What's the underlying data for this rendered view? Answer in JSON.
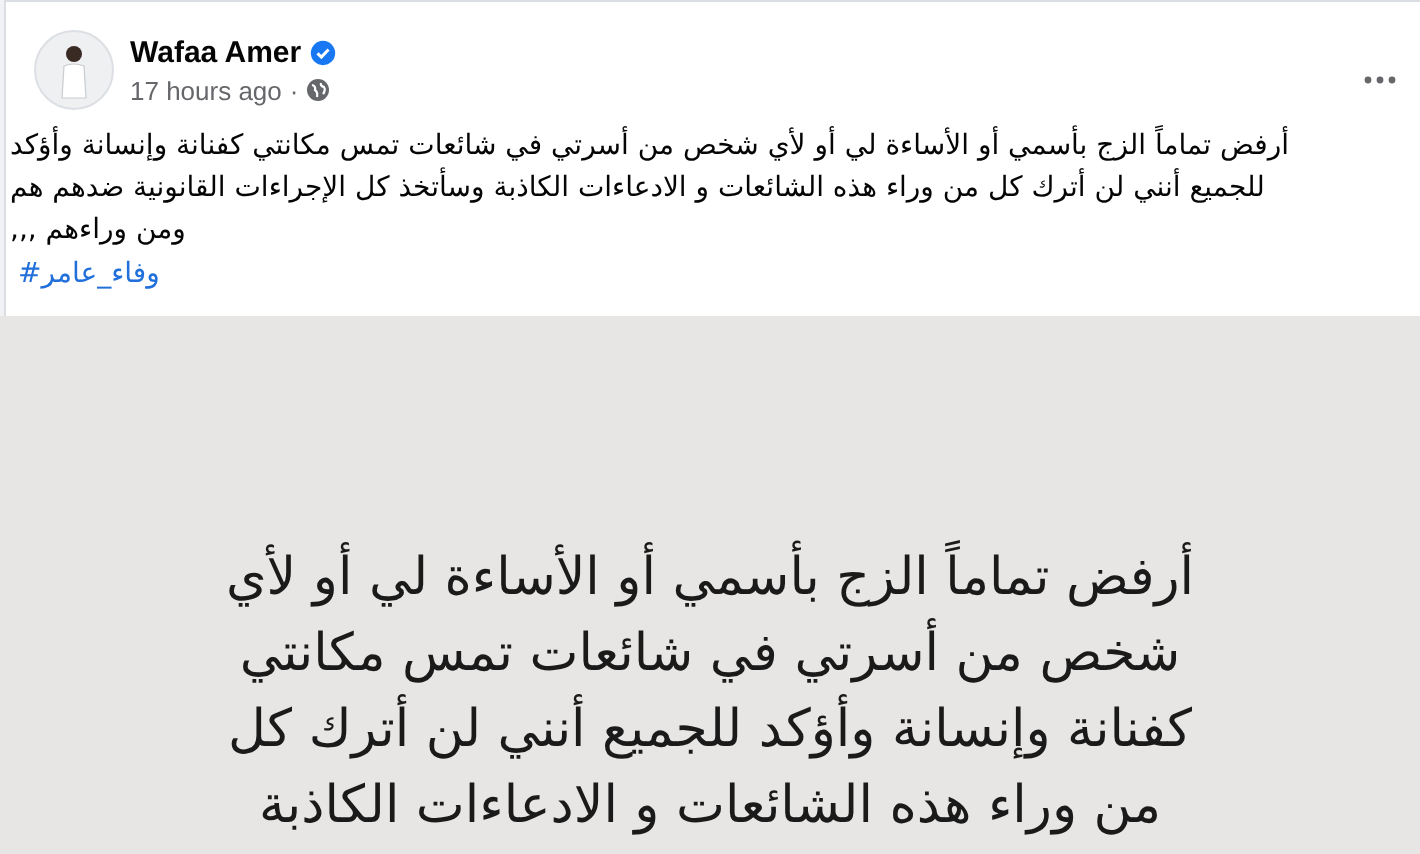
{
  "post": {
    "author": "Wafaa Amer",
    "verified": true,
    "time": "17 hours ago",
    "separator": "·",
    "caption_lines": [
      "أرفض تماماً الزج بأسمي أو الأساءة لي أو لأي شخص من أسرتي في شائعات تمس مكانتي كفنانة وإنسانة وأؤكد",
      "للجميع أنني لن أترك كل من وراء هذه الشائعات و الادعاءات الكاذبة وسأتخذ كل الإجراءات القانونية ضدهم هم",
      "ومن وراءهم ,,,"
    ],
    "hashtag": "#وفاء_عامر",
    "image_lines": [
      "أرفض تماماً الزج بأسمي أو الأساءة لي أو لأي",
      "شخص من أسرتي في شائعات تمس مكانتي",
      "كفنانة وإنسانة وأؤكد للجميع أنني لن أترك كل",
      "من وراء هذه الشائعات و الادعاءات الكاذبة"
    ]
  }
}
